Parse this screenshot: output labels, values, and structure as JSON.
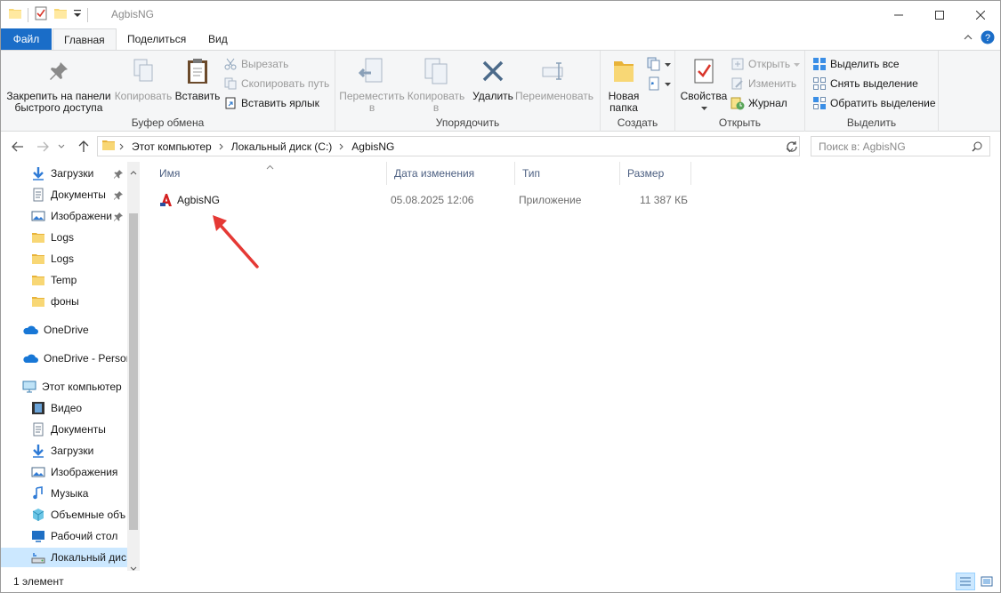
{
  "window": {
    "title": "AgbisNG"
  },
  "tabs": [
    {
      "label": "Файл"
    },
    {
      "label": "Главная"
    },
    {
      "label": "Поделиться"
    },
    {
      "label": "Вид"
    }
  ],
  "ribbon": {
    "clipboard": {
      "label": "Буфер обмена",
      "pin_line1": "Закрепить на панели",
      "pin_line2": "быстрого доступа",
      "copy": "Копировать",
      "paste": "Вставить",
      "cut": "Вырезать",
      "copy_path": "Скопировать путь",
      "paste_shortcut": "Вставить ярлык"
    },
    "organize": {
      "label": "Упорядочить",
      "move_line1": "Переместить",
      "move_line2": "в",
      "copyto_line1": "Копировать",
      "copyto_line2": "в",
      "delete": "Удалить",
      "rename": "Переименовать"
    },
    "create": {
      "label": "Создать",
      "newfolder_line1": "Новая",
      "newfolder_line2": "папка"
    },
    "open": {
      "label": "Открыть",
      "properties": "Свойства",
      "open": "Открыть",
      "edit": "Изменить",
      "history": "Журнал"
    },
    "select": {
      "label": "Выделить",
      "select_all": "Выделить все",
      "select_none": "Снять выделение",
      "invert": "Обратить выделение"
    }
  },
  "address": {
    "crumbs": [
      "Этот компьютер",
      "Локальный диск (C:)",
      "AgbisNG"
    ],
    "search_placeholder": "Поиск в: AgbisNG"
  },
  "navpane": {
    "items": [
      {
        "label": "Загрузки",
        "icon": "download-icon"
      },
      {
        "label": "Документы",
        "icon": "document-icon"
      },
      {
        "label": "Изображени",
        "icon": "picture-icon"
      },
      {
        "label": "Logs",
        "icon": "folder-icon"
      },
      {
        "label": "Logs",
        "icon": "folder-icon"
      },
      {
        "label": "Temp",
        "icon": "folder-icon"
      },
      {
        "label": "фоны",
        "icon": "folder-icon"
      },
      {
        "label": "OneDrive",
        "icon": "cloud-icon"
      },
      {
        "label": "OneDrive - Person",
        "icon": "cloud-icon"
      },
      {
        "label": "Этот компьютер",
        "icon": "computer-icon"
      },
      {
        "label": "Видео",
        "icon": "video-icon"
      },
      {
        "label": "Документы",
        "icon": "document-icon"
      },
      {
        "label": "Загрузки",
        "icon": "download-icon"
      },
      {
        "label": "Изображения",
        "icon": "picture-icon"
      },
      {
        "label": "Музыка",
        "icon": "music-icon"
      },
      {
        "label": "Объемные объ",
        "icon": "3d-objects-icon"
      },
      {
        "label": "Рабочий стол",
        "icon": "desktop-icon"
      },
      {
        "label": "Локальный дис",
        "icon": "drive-icon"
      }
    ]
  },
  "columns": {
    "name": "Имя",
    "date": "Дата изменения",
    "type": "Тип",
    "size": "Размер"
  },
  "files": [
    {
      "name": "AgbisNG",
      "date": "05.08.2025 12:06",
      "type": "Приложение",
      "size": "11 387 КБ"
    }
  ],
  "status": {
    "count": "1 элемент"
  },
  "colors": {
    "accent": "#1a6dc8",
    "selection": "#cce8ff",
    "annotation": "#e53935"
  }
}
